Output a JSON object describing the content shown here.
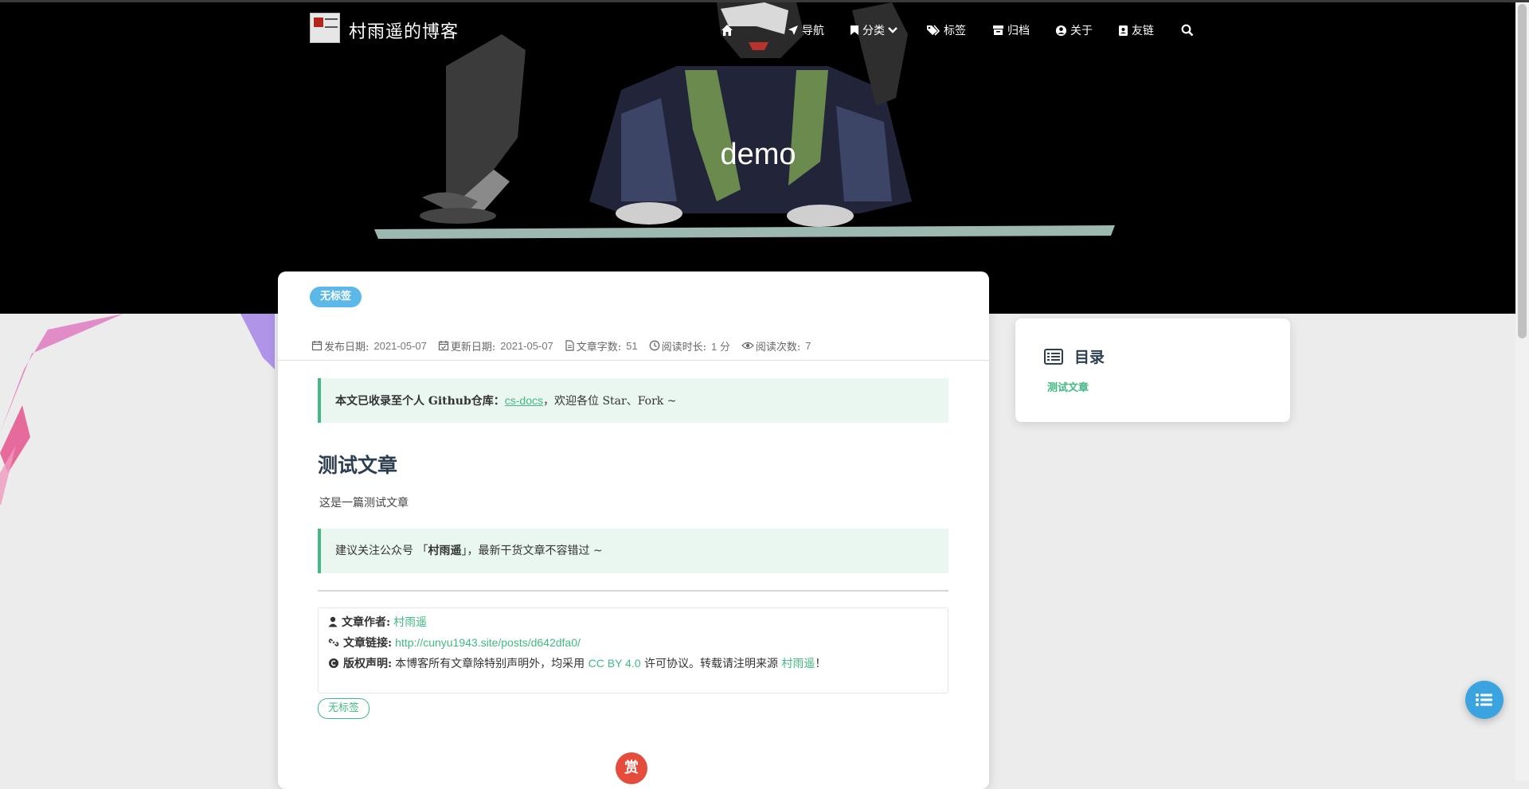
{
  "site": {
    "title": "村雨遥的博客"
  },
  "nav": {
    "items": [
      {
        "label": "",
        "icon": "home-icon"
      },
      {
        "label": "导航",
        "icon": "paper-plane-icon"
      },
      {
        "label": "分类",
        "icon": "bookmark-icon"
      },
      {
        "label": "标签",
        "icon": "tags-icon"
      },
      {
        "label": "归档",
        "icon": "archive-icon"
      },
      {
        "label": "关于",
        "icon": "user-circle-icon"
      },
      {
        "label": "友链",
        "icon": "address-book-icon"
      }
    ],
    "search_icon": "search-icon"
  },
  "hero": {
    "title": "demo"
  },
  "post": {
    "tag_badge": "无标签",
    "meta": {
      "publish_label": "发布日期:",
      "publish_date": "2021-05-07",
      "update_label": "更新日期:",
      "update_date": "2021-05-07",
      "words_label": "文章字数:",
      "words": "51",
      "read_time_label": "阅读时长:",
      "read_time": "1 分",
      "views_label": "阅读次数:",
      "views": "7"
    },
    "repo_notice": {
      "prefix": "本文已收录至个人 Github仓库：",
      "link": "cs-docs",
      "suffix": "，欢迎各位 Star、Fork ~"
    },
    "heading": "测试文章",
    "body": "这是一篇测试文章",
    "follow_notice": {
      "prefix": "建议关注公众号 「",
      "name": "村雨遥",
      "suffix": "」，最新干货文章不容错过 ~"
    },
    "copyright": {
      "author_label": "文章作者:",
      "author": "村雨遥",
      "link_label": "文章链接:",
      "link": "http://cunyu1943.site/posts/d642dfa0/",
      "license_label": "版权声明:",
      "license_prefix": "本博客所有文章除特别声明外，均采用",
      "license_name": "CC BY 4.0",
      "license_middle": "许可协议。转载请注明来源",
      "license_source": "村雨遥",
      "license_end": "！"
    },
    "tag_outline": "无标签",
    "reward": "赏"
  },
  "toc": {
    "title": "目录",
    "items": [
      "测试文章"
    ]
  },
  "colors": {
    "accent": "#42b983",
    "badge_blue": "#5bb8e9",
    "reward_red": "#e64c3c",
    "fab_blue": "#3aa3e0"
  }
}
